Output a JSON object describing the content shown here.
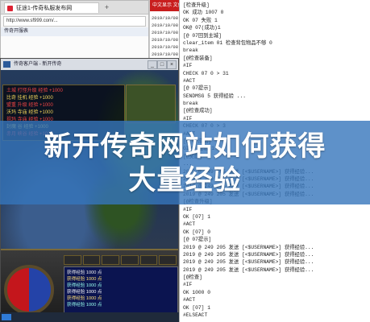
{
  "browser": {
    "tab_title": "征途1-传奇私服发布网",
    "tab_add": "+",
    "address": "http://www.sf999.com/...",
    "page_title": "传奇开服表"
  },
  "log_panel_header": {
    "title": "中文显示 文件",
    "lines": [
      "2019/10/08 02",
      "2019/10/08 02",
      "2019/10/08 02",
      "2019/10/08 02",
      "2019/10/08 02",
      "2019/10/08 02",
      "2019/10/08 02"
    ]
  },
  "notepad": {
    "lines": [
      "[检查升级]",
      "OK 成功 1007 0",
      "OK 07 失败 1",
      "OK@ 07(成功)1",
      "[@ 07回到主城]",
      "clear_item 01 检查背包物品不够 0",
      "break",
      "[@检查装备]",
      "#IF",
      "CHECK 07 0 > 31",
      "#ACT",
      "[@ 07提示]",
      "SENDMSG 5 获得经验 ...",
      "break",
      "[@检查成功]",
      "#IF",
      "CHECK 07 0 > 3",
      "#ACT",
      "[@ 07成功]",
      "GIVE 经验 1",
      "[@奖励]",
      "...",
      "2019 @ 249 205 发送 [<$USERNAME>] 获得经验...",
      "2019 @ 249 205 发送 [<$USERNAME>] 获得经验...",
      "2019 @ 249 205 发送 [<$USERNAME>] 获得经验...",
      "2019 @ 249 205 发送 [<$USERNAME>] 获得经验...",
      "[@检查升级]",
      "#IF",
      "OK [07] 1",
      "#ACT",
      "OK [07] 0",
      "[@ 07提示]",
      "2019 @ 249 205 发送 [<$USERNAME>] 获得经验...",
      "2019 @ 249 205 发送 [<$USERNAME>] 获得经验...",
      "2019 @ 249 205 发送 [<$USERNAME>] 获得经验...",
      "2019 @ 249 205 发送 [<$USERNAME>] 获得经验...",
      "[@检查]",
      "#IF",
      "OK 1000 0",
      "#ACT",
      "OK [07] 1",
      "#ELSEACT"
    ]
  },
  "game": {
    "window_title": "传奇客户端 - 新开传奇",
    "minimize": "_",
    "maximize": "□",
    "close": "×",
    "top_rows": [
      "土城 打怪升级  经验 +1000",
      "比奇 挂机     经验 +1000",
      "盟重 升级     经验 +1000",
      "沃玛 寺庙     经验 +1000",
      "祖玛 寺庙     经验 +1000",
      "封魔 谷      经验 +1000",
      "赤月 峡谷     经验 +1000"
    ],
    "chat": [
      "获得经验 1000 点",
      "获得经验 1000 点",
      "获得经验 1000 点",
      "获得经验 1000 点",
      "获得经验 1000 点",
      "获得经验 1000 点"
    ]
  },
  "banner": {
    "line1": "新开传奇网站如何获得",
    "line2": "大量经验"
  }
}
